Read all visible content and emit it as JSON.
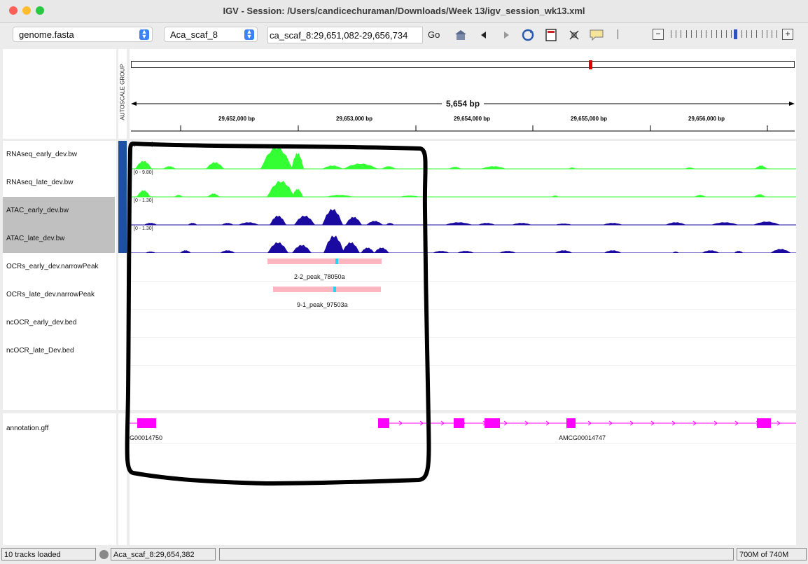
{
  "window": {
    "title": "IGV - Session: /Users/candicechuraman/Downloads/Week 13/igv_session_wk13.xml"
  },
  "toolbar": {
    "genome": "genome.fasta",
    "chromosome": "Aca_scaf_8",
    "locus": "ca_scaf_8:29,651,082-29,656,734",
    "go_label": "Go",
    "icons": [
      "home-icon",
      "back-icon",
      "forward-icon",
      "refresh-icon",
      "roi-icon",
      "resize-icon",
      "popup-info-icon"
    ]
  },
  "ruler": {
    "span_label": "5,654 bp",
    "ticks": [
      "29,652,000 bp",
      "29,653,000 bp",
      "29,654,000 bp",
      "29,655,000 bp",
      "29,656,000 bp"
    ],
    "attribute_header": "AUTOSCALE GROUP"
  },
  "tracks": [
    {
      "name": "RNAseq_early_dev.bw",
      "range": "[0 - 9.80]",
      "color": "#33ff33"
    },
    {
      "name": "RNAseq_late_dev.bw",
      "range": "[0 - 9.80]",
      "color": "#33ff33"
    },
    {
      "name": "ATAC_early_dev.bw",
      "range": "[0 - 1.30]",
      "color": "#1a0aa0"
    },
    {
      "name": "ATAC_late_dev.bw",
      "range": "[0 - 1.30]",
      "color": "#1a0aa0"
    },
    {
      "name": "OCRs_early_dev.narrowPeak",
      "peak": "2-2_peak_78050a"
    },
    {
      "name": "OCRs_late_dev.narrowPeak",
      "peak": "9-1_peak_97503a"
    },
    {
      "name": "ncOCR_early_dev.bed"
    },
    {
      "name": "ncOCR_late_Dev.bed"
    }
  ],
  "annotation": {
    "name": "annotation.gff",
    "gene_left": "G00014750",
    "gene_right": "AMCG00014747",
    "color": "#ff00ff"
  },
  "status": {
    "tracks_loaded": "10 tracks loaded",
    "position": "Aca_scaf_8:29,654,382",
    "memory": "700M of 740M"
  }
}
